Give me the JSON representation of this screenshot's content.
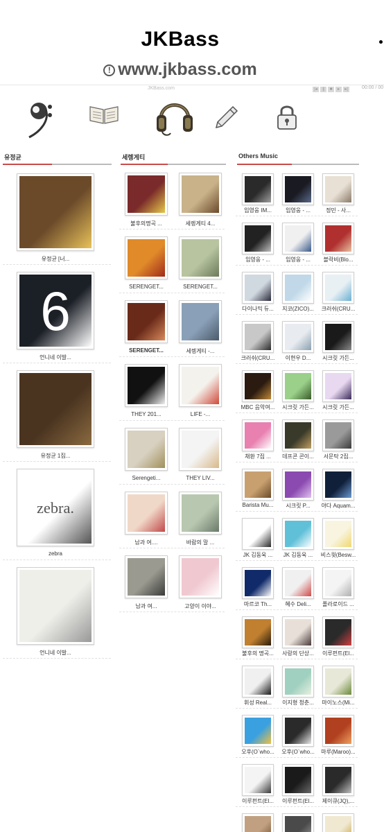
{
  "site": {
    "title": "JKBass",
    "url": "www.jkbass.com"
  },
  "player": {
    "title": "JKBass.com",
    "time": "00:00 / 00"
  },
  "nav": [
    {
      "name": "bass-clef-icon"
    },
    {
      "name": "book-icon"
    },
    {
      "name": "headphones-icon"
    },
    {
      "name": "pencil-icon"
    },
    {
      "name": "lock-icon"
    }
  ],
  "columns": {
    "col1": {
      "heading": "유정균",
      "albums": [
        {
          "caption": "유정균 [너...",
          "color": "#6b4a2a",
          "accent": "#e8c25a"
        },
        {
          "caption": "언니네 이발...",
          "color": "#1b1f26",
          "accent": "#ffffff",
          "text": "6"
        },
        {
          "caption": "유정균 1집...",
          "color": "#4a3420",
          "accent": "#8a6a40"
        },
        {
          "caption": "zebra",
          "color": "#ffffff",
          "accent": "#555555",
          "text": "zebra."
        },
        {
          "caption": "언니네 이발...",
          "color": "#efefea",
          "accent": "#999999"
        }
      ]
    },
    "col2": {
      "heading": "세렝게티",
      "albums": [
        {
          "caption": "불후의명곡 ...",
          "color": "#7a2a2a",
          "accent": "#e6c84a"
        },
        {
          "caption": "세렝게티 4...",
          "color": "#c9b28a",
          "accent": "#6b4a2a"
        },
        {
          "caption": "SERENGET...",
          "color": "#e08a2a",
          "accent": "#a02a1a"
        },
        {
          "caption": "SERENGET...",
          "color": "#b8c4a0",
          "accent": "#6b7a5a"
        },
        {
          "caption": "SERENGET...",
          "color": "#6a2a1a",
          "accent": "#d88a5a",
          "bold": true
        },
        {
          "caption": "세렝게티 -...",
          "color": "#8aa0b8",
          "accent": "#4a5a6a"
        },
        {
          "caption": "THEY 201...",
          "color": "#111111",
          "accent": "#f0f0f0"
        },
        {
          "caption": "LIFE -...",
          "color": "#f4f2ec",
          "accent": "#d04a3a"
        },
        {
          "caption": "Serengeti...",
          "color": "#d8d0c0",
          "accent": "#a0905a"
        },
        {
          "caption": "THEY LIV...",
          "color": "#f4f4f4",
          "accent": "#d8b88a"
        },
        {
          "caption": "남과 여....",
          "color": "#f0d8c8",
          "accent": "#c04a4a"
        },
        {
          "caption": "바람의 말 ...",
          "color": "#b8c8b0",
          "accent": "#6a7a6a"
        },
        {
          "caption": "남과 여...",
          "color": "#9a9a90",
          "accent": "#3a3a3a"
        },
        {
          "caption": "고양이 이야...",
          "color": "#f0c8d0",
          "accent": "#ffffff"
        }
      ]
    },
    "col3": {
      "heading": "Others Music",
      "albums": [
        {
          "caption": "임영웅 IM...",
          "color": "#2a2a2a",
          "accent": "#a0a0a0"
        },
        {
          "caption": "임영웅 - ...",
          "color": "#1a1a22",
          "accent": "#5a6a8a"
        },
        {
          "caption": "정민 - 사...",
          "color": "#e8e0d4",
          "accent": "#8a7a6a"
        },
        {
          "caption": "임영웅 - ...",
          "color": "#222222",
          "accent": "#c0c0c0"
        },
        {
          "caption": "임영웅 - ...",
          "color": "#f0f0f0",
          "accent": "#3a5a8a"
        },
        {
          "caption": "블락비(Blo...",
          "color": "#b03030",
          "accent": "#e8c0a0"
        },
        {
          "caption": "다이나믹 듀...",
          "color": "#d0d8e0",
          "accent": "#2a2a3a"
        },
        {
          "caption": "지코(ZICO)...",
          "color": "#c0d8e8",
          "accent": "#ffffff"
        },
        {
          "caption": "크러쉬(CRU...",
          "color": "#e8f0f4",
          "accent": "#6ab0d0"
        },
        {
          "caption": "크러쉬(CRU...",
          "color": "#c8c8c8",
          "accent": "#2a2a2a"
        },
        {
          "caption": "이현우 D...",
          "color": "#e8ecf0",
          "accent": "#8aa0b0"
        },
        {
          "caption": "시크릿 가든...",
          "color": "#1a1a1a",
          "accent": "#8a8a8a"
        },
        {
          "caption": "MBC 음악여...",
          "color": "#2a1a10",
          "accent": "#c08a3a"
        },
        {
          "caption": "시크릿 가든...",
          "color": "#9ad08a",
          "accent": "#3a5a2a"
        },
        {
          "caption": "시크릿 가든...",
          "color": "#e8d8f0",
          "accent": "#3a2a5a"
        },
        {
          "caption": "채환 7집 ...",
          "color": "#e880b0",
          "accent": "#ffffff"
        },
        {
          "caption": "데프콘 콘이...",
          "color": "#3a3a2a",
          "accent": "#c0a060"
        },
        {
          "caption": "서문탁 2집...",
          "color": "#9a9a9a",
          "accent": "#3a3a3a"
        },
        {
          "caption": "Barista Mu...",
          "color": "#c8a070",
          "accent": "#6a4a2a"
        },
        {
          "caption": "시크릿 P...",
          "color": "#8a4ab0",
          "accent": "#e0c0f0"
        },
        {
          "caption": "야다 Aquam...",
          "color": "#10203a",
          "accent": "#6a9ad0"
        },
        {
          "caption": "JK 김동욱 ...",
          "color": "#ffffff",
          "accent": "#2a2a2a"
        },
        {
          "caption": "JK 김동욱 ...",
          "color": "#60c0d8",
          "accent": "#ffffff"
        },
        {
          "caption": "비스윗(Besw...",
          "color": "#f8f4e0",
          "accent": "#f0d870"
        },
        {
          "caption": "마르코 Th...",
          "color": "#102a6a",
          "accent": "#ffffff"
        },
        {
          "caption": "혜수 Deli...",
          "color": "#f0f0f0",
          "accent": "#d04a4a"
        },
        {
          "caption": "폴라로이드 ...",
          "color": "#f4f4f4",
          "accent": "#b0b0b0"
        },
        {
          "caption": "불후의 명곡...",
          "color": "#c08030",
          "accent": "#2a1a0a"
        },
        {
          "caption": "사랑의 단상...",
          "color": "#e8e0d8",
          "accent": "#4a3a3a"
        },
        {
          "caption": "이루펀트(El...",
          "color": "#2a2a2a",
          "accent": "#d04040"
        },
        {
          "caption": "휘성 Real...",
          "color": "#f0f0f0",
          "accent": "#1a1a1a"
        },
        {
          "caption": "이지형 청춘...",
          "color": "#a0d0c0",
          "accent": "#e8f0e0"
        },
        {
          "caption": "마이노스(Mi...",
          "color": "#e8e8d8",
          "accent": "#6a8a3a"
        },
        {
          "caption": "오후(O`who...",
          "color": "#3aa0e0",
          "accent": "#f0c040"
        },
        {
          "caption": "오후(O`who...",
          "color": "#2a2a2a",
          "accent": "#e8e8e8"
        },
        {
          "caption": "마루(Maroo)...",
          "color": "#b04020",
          "accent": "#f0a060"
        },
        {
          "caption": "이루펀트(El...",
          "color": "#f4f4f4",
          "accent": "#3a3a3a"
        },
        {
          "caption": "이루펀트(El...",
          "color": "#1a1a1a",
          "accent": "#6a6a6a"
        },
        {
          "caption": "제이큐(JQ),...",
          "color": "#2a2a2a",
          "accent": "#c0c0c0"
        },
        {
          "caption": "",
          "color": "#c0a080",
          "accent": "#6a4a2a"
        },
        {
          "caption": "",
          "color": "#4a4a4a",
          "accent": "#a0a0a0"
        },
        {
          "caption": "",
          "color": "#f0e8d0",
          "accent": "#c0a040"
        }
      ]
    }
  }
}
